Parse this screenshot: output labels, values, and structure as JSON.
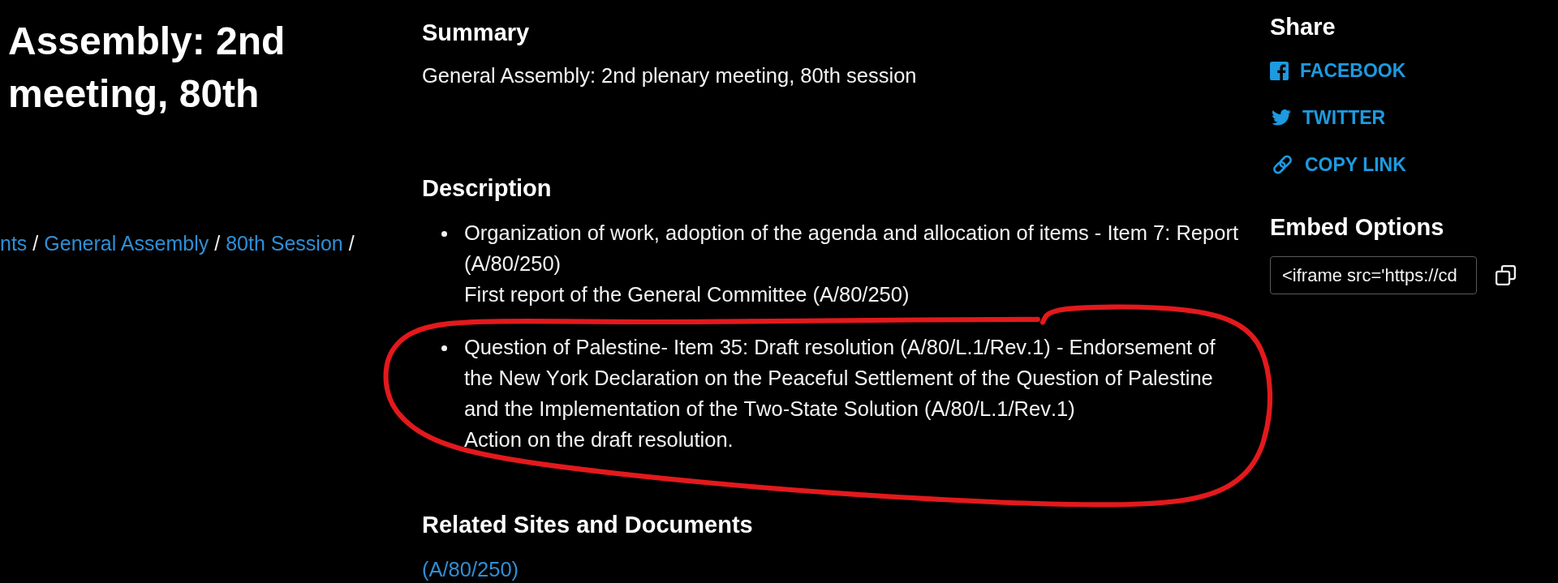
{
  "header": {
    "title": "Assembly: 2nd meeting, 80th",
    "breadcrumb": [
      {
        "kind": "link",
        "text": "nts"
      },
      {
        "kind": "separator",
        "text": "/"
      },
      {
        "kind": "link",
        "text": "General Assembly"
      },
      {
        "kind": "separator",
        "text": "/"
      },
      {
        "kind": "link",
        "text": "80th Session"
      },
      {
        "kind": "separator",
        "text": "/"
      }
    ]
  },
  "summary": {
    "heading": "Summary",
    "text": "General Assembly: 2nd plenary meeting, 80th session"
  },
  "description": {
    "heading": "Description",
    "items": [
      {
        "title": "Organization of work, adoption of the agenda and allocation of items - Item 7: Report (A/80/250)",
        "note": "First report of the General Committee (A/80/250)",
        "circled": false
      },
      {
        "title": "Question of Palestine- Item 35: Draft resolution (A/80/L.1/Rev.1) - Endorsement of the New York Declaration on the Peaceful Settlement of the Question of Palestine and the Implementation of the Two-State Solution (A/80/L.1/Rev.1)",
        "note": "Action on the draft resolution.",
        "circled": true
      }
    ]
  },
  "related": {
    "heading": "Related Sites and Documents",
    "links": [
      "(A/80/250)"
    ]
  },
  "share": {
    "heading": "Share",
    "links": [
      {
        "kind": "facebook",
        "label": "FACEBOOK"
      },
      {
        "kind": "twitter",
        "label": "TWITTER"
      },
      {
        "kind": "copy_link",
        "label": "COPY LINK"
      }
    ]
  },
  "embed": {
    "heading": "Embed Options",
    "value": "<iframe src='https://cd"
  }
}
